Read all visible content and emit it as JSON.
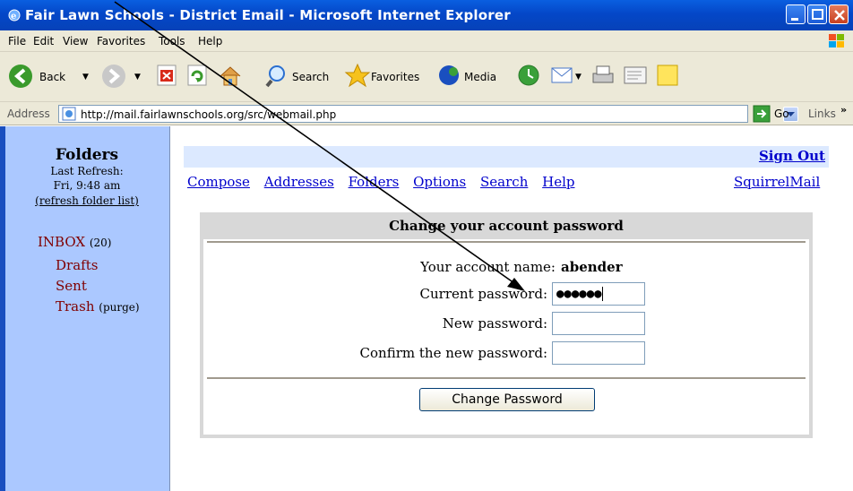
{
  "window": {
    "title": "Fair Lawn Schools - District Email - Microsoft Internet Explorer"
  },
  "menu": [
    "File",
    "Edit",
    "View",
    "Favorites",
    "Tools",
    "Help"
  ],
  "toolbar": {
    "back": "Back",
    "search": "Search",
    "favorites": "Favorites",
    "media": "Media"
  },
  "address": {
    "label": "Address",
    "url": "http://mail.fairlawnschools.org/src/webmail.php",
    "go": "Go",
    "links": "Links",
    "more": "»"
  },
  "sidebar": {
    "title": "Folders",
    "last_refresh": "Last Refresh:",
    "refresh_time": "Fri, 9:48 am",
    "refresh_link": "(refresh folder list)",
    "folders": [
      {
        "name": "INBOX",
        "count": "(20)"
      },
      {
        "name": "Drafts"
      },
      {
        "name": "Sent"
      },
      {
        "name": "Trash",
        "action": "(purge)"
      }
    ]
  },
  "header": {
    "signout": "Sign Out",
    "nav": [
      "Compose",
      "Addresses",
      "Folders",
      "Options",
      "Search",
      "Help"
    ],
    "brand": "SquirrelMail"
  },
  "form": {
    "title": "Change your account password",
    "account_label": "Your account name:",
    "account_value": "abender",
    "current_label": "Current password:",
    "current_value": "●●●●●●",
    "new_label": "New password:",
    "new_value": "",
    "confirm_label": "Confirm the new password:",
    "confirm_value": "",
    "submit": "Change Password"
  },
  "colors": {
    "sidebar_bg": "#abc8ff",
    "link": "#0000cc",
    "folder": "#800000",
    "band": "#dce9ff"
  }
}
